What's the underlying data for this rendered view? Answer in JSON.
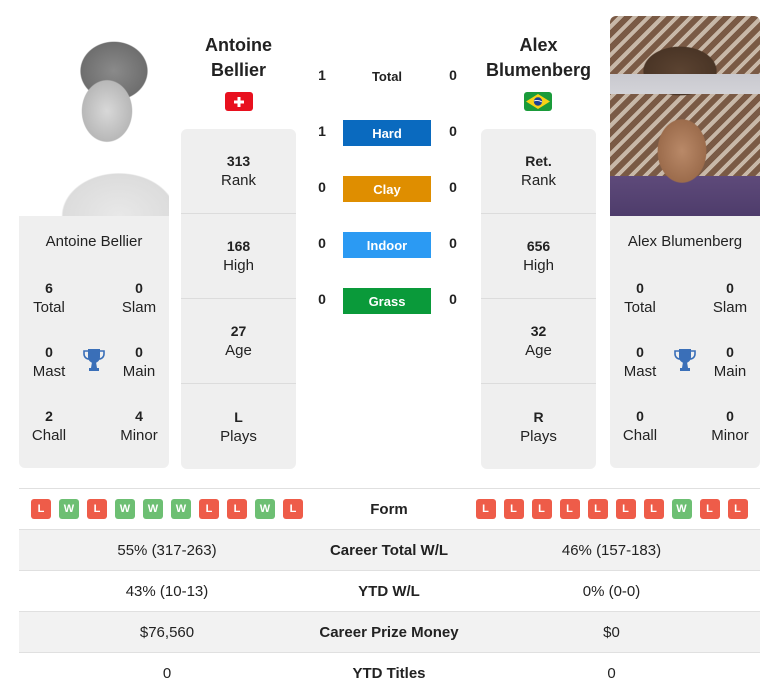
{
  "player1": {
    "name_line1": "Antoine",
    "name_line2": "Bellier",
    "full_name": "Antoine Bellier",
    "flag": "switzerland-flag",
    "stats": [
      {
        "value": "313",
        "label": "Rank"
      },
      {
        "value": "168",
        "label": "High"
      },
      {
        "value": "27",
        "label": "Age"
      },
      {
        "value": "L",
        "label": "Plays"
      }
    ],
    "titles": {
      "total": {
        "value": "6",
        "label": "Total"
      },
      "slam": {
        "value": "0",
        "label": "Slam"
      },
      "mast": {
        "value": "0",
        "label": "Mast"
      },
      "main": {
        "value": "0",
        "label": "Main"
      },
      "chall": {
        "value": "2",
        "label": "Chall"
      },
      "minor": {
        "value": "4",
        "label": "Minor"
      }
    },
    "form": [
      "L",
      "W",
      "L",
      "W",
      "W",
      "W",
      "L",
      "L",
      "W",
      "L"
    ]
  },
  "player2": {
    "name_line1": "Alex",
    "name_line2": "Blumenberg",
    "full_name": "Alex Blumenberg",
    "flag": "brazil-flag",
    "stats": [
      {
        "value": "Ret.",
        "label": "Rank"
      },
      {
        "value": "656",
        "label": "High"
      },
      {
        "value": "32",
        "label": "Age"
      },
      {
        "value": "R",
        "label": "Plays"
      }
    ],
    "titles": {
      "total": {
        "value": "0",
        "label": "Total"
      },
      "slam": {
        "value": "0",
        "label": "Slam"
      },
      "mast": {
        "value": "0",
        "label": "Mast"
      },
      "main": {
        "value": "0",
        "label": "Main"
      },
      "chall": {
        "value": "0",
        "label": "Chall"
      },
      "minor": {
        "value": "0",
        "label": "Minor"
      }
    },
    "form": [
      "L",
      "L",
      "L",
      "L",
      "L",
      "L",
      "L",
      "W",
      "L",
      "L"
    ]
  },
  "h2h": [
    {
      "label": "Total",
      "p1": "1",
      "p2": "0",
      "color": null
    },
    {
      "label": "Hard",
      "p1": "1",
      "p2": "0",
      "color": "#0a6abf"
    },
    {
      "label": "Clay",
      "p1": "0",
      "p2": "0",
      "color": "#df8e00"
    },
    {
      "label": "Indoor",
      "p1": "0",
      "p2": "0",
      "color": "#2b9af3"
    },
    {
      "label": "Grass",
      "p1": "0",
      "p2": "0",
      "color": "#0a9a3a"
    }
  ],
  "comparison": {
    "form_label": "Form",
    "rows": [
      {
        "label": "Career Total W/L",
        "p1": "55% (317-263)",
        "p2": "46% (157-183)"
      },
      {
        "label": "YTD W/L",
        "p1": "43% (10-13)",
        "p2": "0% (0-0)"
      },
      {
        "label": "Career Prize Money",
        "p1": "$76,560",
        "p2": "$0"
      },
      {
        "label": "YTD Titles",
        "p1": "0",
        "p2": "0"
      }
    ]
  },
  "colors": {
    "loss": "#ee5c49",
    "win": "#6dbf73",
    "trophy": "#3a6fb8"
  }
}
